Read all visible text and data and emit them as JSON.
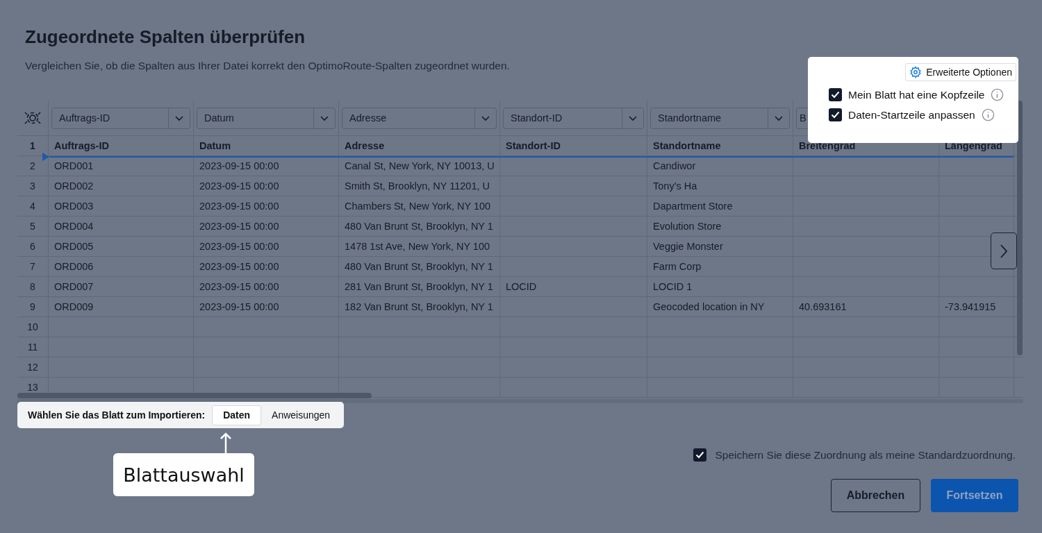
{
  "title": "Zugeordnete Spalten überprüfen",
  "subtitle": "Vergleichen Sie, ob die Spalten aus Ihrer Datei korrekt den OptimoRoute-Spalten zugeordnet wurden.",
  "column_mappings": [
    {
      "value": "Auftrags-ID"
    },
    {
      "value": "Datum"
    },
    {
      "value": "Adresse"
    },
    {
      "value": "Standort-ID"
    },
    {
      "value": "Standortname"
    },
    {
      "value": "B"
    }
  ],
  "table": {
    "rows": [
      {
        "number": "1",
        "kind": "header",
        "cells": [
          "Auftrags-ID",
          "Datum",
          "Adresse",
          "Standort-ID",
          "Standortname",
          "Breitengrad",
          "Längengrad"
        ]
      },
      {
        "number": "2",
        "kind": "data",
        "cells": [
          "ORD001",
          "2023-09-15 00:00",
          "Canal St, New York, NY 10013, U",
          null,
          "Candiwor",
          null,
          null
        ]
      },
      {
        "number": "3",
        "kind": "data",
        "cells": [
          "ORD002",
          "2023-09-15 00:00",
          "Smith St, Brooklyn, NY 11201, U",
          null,
          "Tony's Ha",
          null,
          null
        ]
      },
      {
        "number": "4",
        "kind": "data",
        "cells": [
          "ORD003",
          "2023-09-15 00:00",
          "Chambers St, New York, NY 100",
          null,
          "Dapartment Store",
          null,
          null
        ]
      },
      {
        "number": "5",
        "kind": "data",
        "cells": [
          "ORD004",
          "2023-09-15 00:00",
          "480 Van Brunt St, Brooklyn, NY 1",
          null,
          "Evolution Store",
          null,
          null
        ]
      },
      {
        "number": "6",
        "kind": "data",
        "cells": [
          "ORD005",
          "2023-09-15 00:00",
          "1478 1st Ave, New York, NY 100",
          null,
          "Veggie Monster",
          null,
          null
        ]
      },
      {
        "number": "7",
        "kind": "data",
        "cells": [
          "ORD006",
          "2023-09-15 00:00",
          "480 Van Brunt St, Brooklyn, NY 1",
          null,
          "Farm Corp",
          null,
          null
        ]
      },
      {
        "number": "8",
        "kind": "data",
        "cells": [
          "ORD007",
          "2023-09-15 00:00",
          "281 Van Brunt St, Brooklyn, NY 1",
          "LOCID",
          "LOCID 1",
          null,
          null
        ]
      },
      {
        "number": "9",
        "kind": "data",
        "cells": [
          "ORD009",
          "2023-09-15 00:00",
          "182 Van Brunt St, Brooklyn, NY 1",
          null,
          "Geocoded location in NY",
          "40.693161",
          "-73.941915"
        ]
      },
      {
        "number": "10",
        "kind": "data",
        "cells": [
          null,
          null,
          null,
          null,
          null,
          null,
          null
        ]
      },
      {
        "number": "11",
        "kind": "data",
        "cells": [
          null,
          null,
          null,
          null,
          null,
          null,
          null
        ]
      },
      {
        "number": "12",
        "kind": "data",
        "cells": [
          null,
          null,
          null,
          null,
          null,
          null,
          null
        ]
      },
      {
        "number": "13",
        "kind": "data",
        "cells": [
          null,
          null,
          null,
          null,
          null,
          null,
          null
        ]
      }
    ]
  },
  "advanced_options": {
    "label": "Erweiterte Optionen",
    "options": [
      {
        "label": "Mein Blatt hat eine Kopfzeile",
        "checked": true
      },
      {
        "label": "Daten-Startzeile anpassen",
        "checked": true
      }
    ]
  },
  "sheet_selector": {
    "label": "Wählen Sie das Blatt zum Importieren:",
    "tabs": [
      {
        "label": "Daten",
        "selected": true
      },
      {
        "label": "Anweisungen",
        "selected": false
      }
    ]
  },
  "callout": {
    "text": "Blattauswahl"
  },
  "save_default": {
    "label": "Speichern Sie diese Zuordnung als meine Standardzuordnung.",
    "checked": true
  },
  "buttons": [
    {
      "label": "Abbrechen",
      "kind": "secondary"
    },
    {
      "label": "Fortsetzen",
      "kind": "primary"
    }
  ]
}
